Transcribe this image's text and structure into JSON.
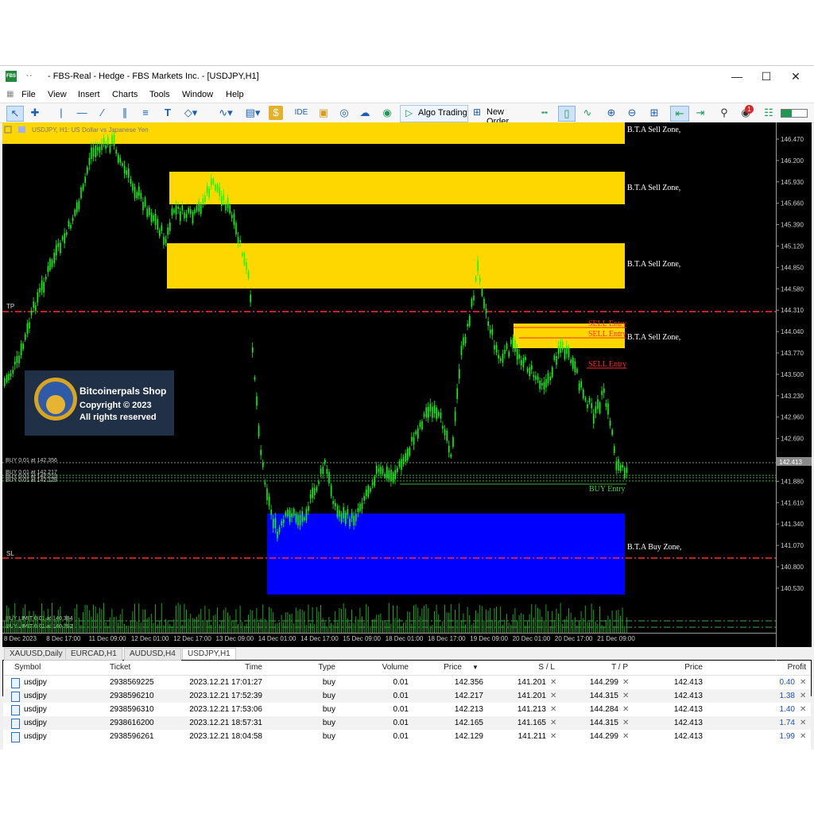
{
  "window": {
    "title": "- FBS-Real - Hedge - FBS Markets Inc. - [USDJPY,H1]",
    "logo": "FBS",
    "quick_access": "ˎˏ",
    "controls": {
      "minimize": "—",
      "maximize": "☐",
      "close": "✕"
    }
  },
  "menu": [
    "File",
    "View",
    "Insert",
    "Charts",
    "Tools",
    "Window",
    "Help"
  ],
  "toolbar": {
    "ide_label": "IDE",
    "algo_trading_label": "Algo Trading",
    "new_order_label": "New Order",
    "notification_count": "1"
  },
  "chart": {
    "header": "USDJPY, H1:  US Dollar vs Japanese Yen",
    "background": "#000000",
    "candle_color": "#00ff00",
    "price_axis": [
      "146.470",
      "146.200",
      "145.930",
      "145.660",
      "145.390",
      "145.120",
      "144.850",
      "144.580",
      "144.310",
      "144.040",
      "143.770",
      "143.500",
      "143.230",
      "142.960",
      "142.690",
      "142.413",
      "142.150",
      "141.880",
      "141.610",
      "141.340",
      "141.070",
      "140.800",
      "140.530"
    ],
    "current_price": "142.413",
    "time_axis": [
      "8 Dec 2023",
      "8 Dec 17:00",
      "11 Dec 09:00",
      "12 Dec 01:00",
      "12 Dec 17:00",
      "13 Dec 09:00",
      "14 Dec 01:00",
      "14 Dec 17:00",
      "15 Dec 09:00",
      "18 Dec 01:00",
      "18 Dec 17:00",
      "19 Dec 09:00",
      "20 Dec 01:00",
      "20 Dec 17:00",
      "21 Dec 09:00"
    ],
    "zones": {
      "sell_label": "B.T.A  Sell Zone,",
      "buy_label": "B.T.A  Buy Zone,",
      "sell_color": "#ffd700",
      "buy_color": "#0000ff"
    },
    "labels": {
      "sell_entry": "SELL Entry",
      "buy_entry": "BUY Entry",
      "tp": "TP",
      "sl": "SL",
      "buy_lines": [
        "BUY 0.01 at 142.356",
        "BUY 0.01 at 142.217",
        "BUY 0.01 at 142.213",
        "BUY 0.01 at 142.129"
      ],
      "buy_limit_lines": [
        "BUY LIMIT 0.01 at 140.384",
        "BUY LIMIT 0.01 at 140.292"
      ]
    },
    "watermark": {
      "line1": "Bitcoinerpals Shop",
      "line2": "Copyright © 2023",
      "line3": "All rights reserved"
    }
  },
  "tabs": [
    "XAUUSD,Daily",
    "EURCAD,H1",
    "AUDUSD,H4",
    "USDJPY,H1"
  ],
  "active_tab": "USDJPY,H1",
  "table": {
    "headers": {
      "symbol": "Symbol",
      "ticket": "Ticket",
      "time": "Time",
      "type": "Type",
      "volume": "Volume",
      "price": "Price",
      "sort": "▼",
      "sl": "S / L",
      "tp": "T / P",
      "cur_price": "Price",
      "profit": "Profit"
    },
    "rows": [
      {
        "symbol": "usdjpy",
        "ticket": "2938569225",
        "time": "2023.12.21 17:01:27",
        "type": "buy",
        "volume": "0.01",
        "price": "142.356",
        "sl": "141.201",
        "tp": "144.299",
        "cur_price": "142.413",
        "profit": "0.40"
      },
      {
        "symbol": "usdjpy",
        "ticket": "2938596210",
        "time": "2023.12.21 17:52:39",
        "type": "buy",
        "volume": "0.01",
        "price": "142.217",
        "sl": "141.201",
        "tp": "144.315",
        "cur_price": "142.413",
        "profit": "1.38"
      },
      {
        "symbol": "usdjpy",
        "ticket": "2938596310",
        "time": "2023.12.21 17:53:06",
        "type": "buy",
        "volume": "0.01",
        "price": "142.213",
        "sl": "141.213",
        "tp": "144.284",
        "cur_price": "142.413",
        "profit": "1.40"
      },
      {
        "symbol": "usdjpy",
        "ticket": "2938616200",
        "time": "2023.12.21 18:57:31",
        "type": "buy",
        "volume": "0.01",
        "price": "142.165",
        "sl": "141.165",
        "tp": "144.315",
        "cur_price": "142.413",
        "profit": "1.74"
      },
      {
        "symbol": "usdjpy",
        "ticket": "2938596261",
        "time": "2023.12.21 18:04:58",
        "type": "buy",
        "volume": "0.01",
        "price": "142.129",
        "sl": "141.211",
        "tp": "144.299",
        "cur_price": "142.413",
        "profit": "1.99"
      }
    ],
    "delete_glyph": "✕"
  }
}
